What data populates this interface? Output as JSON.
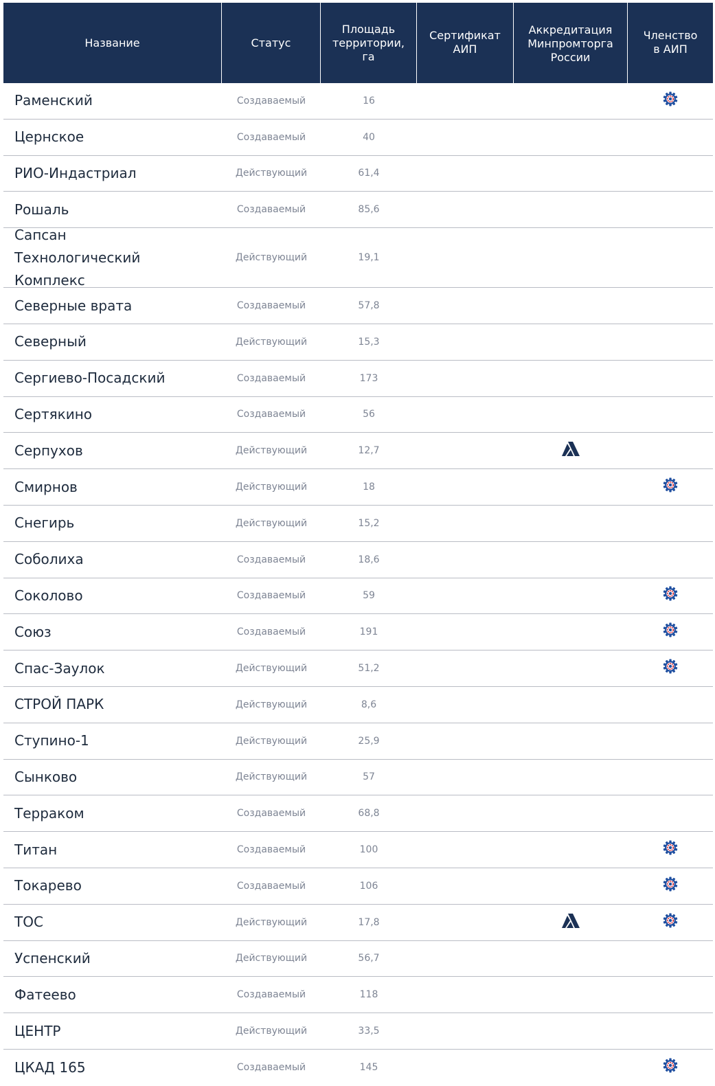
{
  "header": {
    "name": "Название",
    "status": "Статус",
    "area": "Площадь\nтерритории,\nга",
    "cert": "Сертификат\nАИП",
    "accreditation": "Аккредитация\nМинпромторга\nРоссии",
    "membership": "Членство\nв АИП"
  },
  "colors": {
    "header_bg": "#1b3155",
    "gear_blue": "#1f4fa0",
    "gear_red": "#d8212a",
    "accr_navy": "#1b3155"
  },
  "rows": [
    {
      "name": "Раменский",
      "status": "Создаваемый",
      "area": "16",
      "member": true,
      "accredited": false
    },
    {
      "name": "Цернское",
      "status": "Создаваемый",
      "area": "40",
      "member": false,
      "accredited": false
    },
    {
      "name": "РИО-Индастриал",
      "status": "Действующий",
      "area": "61,4",
      "member": false,
      "accredited": false
    },
    {
      "name": "Рошаль",
      "status": "Создаваемый",
      "area": "85,6",
      "member": false,
      "accredited": false
    },
    {
      "name": "Сапсан Технологический Комплекс",
      "status": "Действующий",
      "area": "19,1",
      "member": false,
      "accredited": false
    },
    {
      "name": "Северные врата",
      "status": "Создаваемый",
      "area": "57,8",
      "member": false,
      "accredited": false
    },
    {
      "name": "Северный",
      "status": "Действующий",
      "area": "15,3",
      "member": false,
      "accredited": false
    },
    {
      "name": "Сергиево-Посадский",
      "status": "Создаваемый",
      "area": "173",
      "member": false,
      "accredited": false
    },
    {
      "name": "Сертякино",
      "status": "Создаваемый",
      "area": "56",
      "member": false,
      "accredited": false
    },
    {
      "name": "Серпухов",
      "status": "Действующий",
      "area": "12,7",
      "member": false,
      "accredited": true
    },
    {
      "name": "Смирнов",
      "status": "Действующий",
      "area": "18",
      "member": true,
      "accredited": false
    },
    {
      "name": "Снегирь",
      "status": "Действующий",
      "area": "15,2",
      "member": false,
      "accredited": false
    },
    {
      "name": "Соболиха",
      "status": "Создаваемый",
      "area": "18,6",
      "member": false,
      "accredited": false
    },
    {
      "name": "Соколово",
      "status": "Создаваемый",
      "area": "59",
      "member": true,
      "accredited": false
    },
    {
      "name": "Союз",
      "status": "Создаваемый",
      "area": "191",
      "member": true,
      "accredited": false
    },
    {
      "name": "Спас-Заулок",
      "status": "Действующий",
      "area": "51,2",
      "member": true,
      "accredited": false
    },
    {
      "name": "СТРОЙ ПАРК",
      "status": "Действующий",
      "area": "8,6",
      "member": false,
      "accredited": false
    },
    {
      "name": "Ступино-1",
      "status": "Действующий",
      "area": "25,9",
      "member": false,
      "accredited": false
    },
    {
      "name": "Сынково",
      "status": "Действующий",
      "area": "57",
      "member": false,
      "accredited": false
    },
    {
      "name": "Терраком",
      "status": "Создаваемый",
      "area": "68,8",
      "member": false,
      "accredited": false
    },
    {
      "name": "Титан",
      "status": "Создаваемый",
      "area": "100",
      "member": true,
      "accredited": false
    },
    {
      "name": "Токарево",
      "status": "Создаваемый",
      "area": "106",
      "member": true,
      "accredited": false
    },
    {
      "name": "ТОС",
      "status": "Действующий",
      "area": "17,8",
      "member": true,
      "accredited": true
    },
    {
      "name": "Успенский",
      "status": "Действующий",
      "area": "56,7",
      "member": false,
      "accredited": false
    },
    {
      "name": "Фатеево",
      "status": "Создаваемый",
      "area": "118",
      "member": false,
      "accredited": false
    },
    {
      "name": "ЦЕНТР",
      "status": "Действующий",
      "area": "33,5",
      "member": false,
      "accredited": false
    },
    {
      "name": "ЦКАД 165",
      "status": "Создаваемый",
      "area": "145",
      "member": true,
      "accredited": false
    }
  ]
}
